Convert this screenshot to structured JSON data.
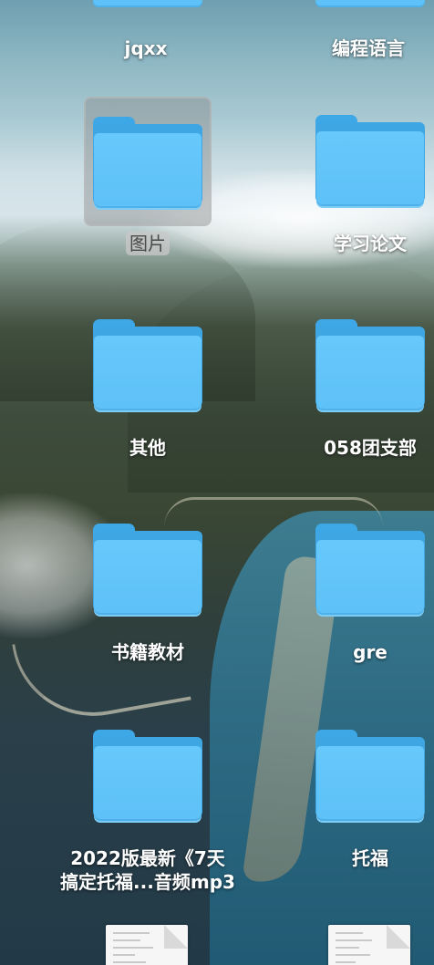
{
  "desktop": {
    "items": [
      {
        "id": "jqxx",
        "label": "jqxx"
      },
      {
        "id": "biancheng",
        "label": "编程语言"
      },
      {
        "id": "tupian",
        "label": "图片",
        "selected": true
      },
      {
        "id": "xuexilunwen",
        "label": "学习论文"
      },
      {
        "id": "qita",
        "label": "其他"
      },
      {
        "id": "tuanzhibu",
        "label": "058团支部"
      },
      {
        "id": "shuji",
        "label": "书籍教材"
      },
      {
        "id": "gre",
        "label": "gre"
      },
      {
        "id": "tuofu2022",
        "label": "2022版最新《7天\n搞定托福...音频mp3"
      },
      {
        "id": "tuofu",
        "label": "托福"
      }
    ],
    "icons": {
      "folder": "folder-icon",
      "document": "document-icon"
    },
    "colors": {
      "folder_front": "#66c8fb",
      "folder_back": "#3fa6e4",
      "selection_bg": "#8c8c8c",
      "label_text": "#ffffff"
    }
  }
}
